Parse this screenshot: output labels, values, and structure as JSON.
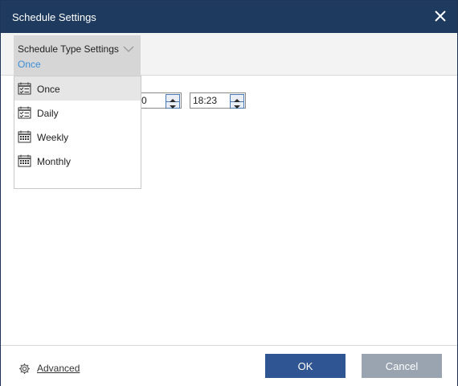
{
  "window": {
    "title": "Schedule Settings"
  },
  "schedule_type": {
    "label": "Schedule Type Settings",
    "selected": "Once",
    "options": [
      {
        "label": "Once",
        "icon": "calendar-check-icon",
        "selected": true
      },
      {
        "label": "Daily",
        "icon": "calendar-check-icon",
        "selected": false
      },
      {
        "label": "Weekly",
        "icon": "calendar-grid-icon",
        "selected": false
      },
      {
        "label": "Monthly",
        "icon": "calendar-grid-icon",
        "selected": false
      }
    ]
  },
  "fields": {
    "date_value_partial": "0",
    "time_value": "18:23"
  },
  "footer": {
    "advanced_label": "Advanced",
    "ok_label": "OK",
    "cancel_label": "Cancel"
  },
  "colors": {
    "titlebar": "#1e3a5f",
    "accent_text": "#3a8fd8",
    "ok_button": "#2f5592",
    "cancel_button": "#9aa4b1"
  }
}
